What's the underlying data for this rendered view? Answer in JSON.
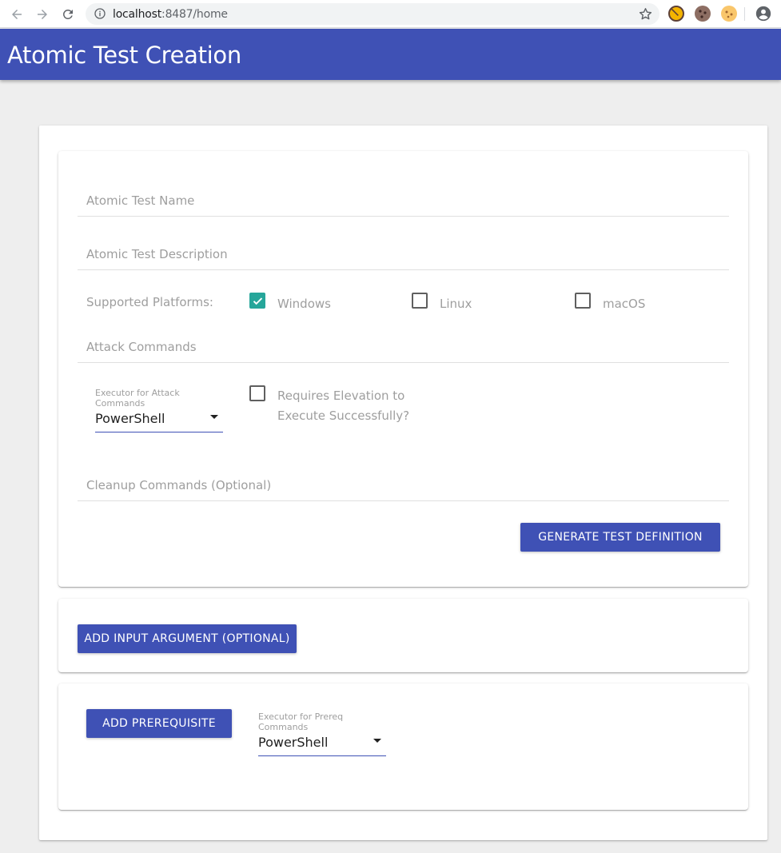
{
  "browser": {
    "url_host": "localhost",
    "url_rest": ":8487/home"
  },
  "app": {
    "title": "Atomic Test Creation"
  },
  "form": {
    "name_label": "Atomic Test Name",
    "description_label": "Atomic Test Description",
    "platforms_label": "Supported Platforms:",
    "platforms": [
      {
        "label": "Windows",
        "checked": true
      },
      {
        "label": "Linux",
        "checked": false
      },
      {
        "label": "macOS",
        "checked": false
      }
    ],
    "attack_commands_label": "Attack Commands",
    "executor_caption": "Executor for Attack Commands",
    "executor_value": "PowerShell",
    "elevation_line1": "Requires Elevation to",
    "elevation_line2": "Execute Successfully?",
    "elevation_checked": false,
    "cleanup_label": "Cleanup Commands (Optional)",
    "generate_button": "Generate Test Definition"
  },
  "arguments": {
    "add_button": "Add Input Argument (Optional)"
  },
  "prereq": {
    "add_button": "Add Prerequisite",
    "executor_caption": "Executor for Prereq Commands",
    "executor_value": "PowerShell"
  },
  "colors": {
    "primary": "#3f51b5",
    "checkbox_checked": "#26a69a"
  }
}
